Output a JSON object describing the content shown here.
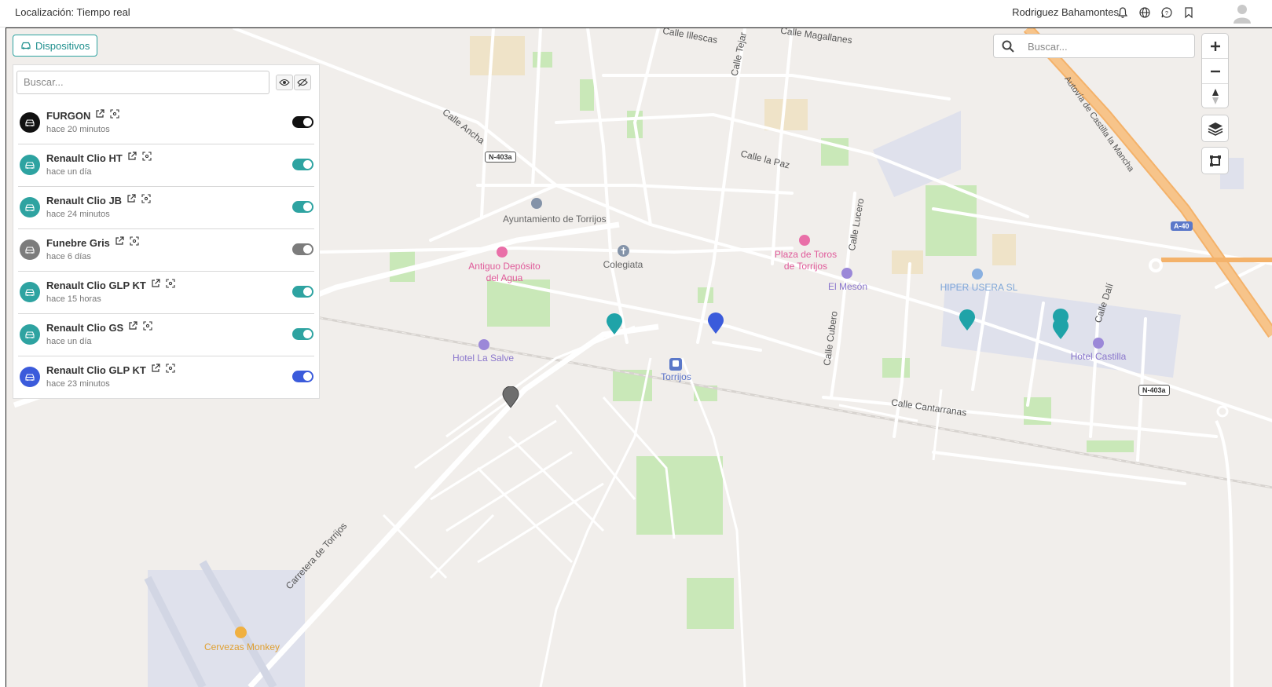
{
  "header": {
    "title": "Localización: Tiempo real",
    "user": "Rodriguez Bahamontes"
  },
  "devices_button": {
    "label": "Dispositivos"
  },
  "panel": {
    "search_placeholder": "Buscar...",
    "devices": [
      {
        "name": "FURGON",
        "last_seen": "hace 20 minutos",
        "color": "#111111",
        "enabled": true
      },
      {
        "name": "Renault Clio HT",
        "last_seen": "hace un día",
        "color": "#2ea3a1",
        "enabled": true
      },
      {
        "name": "Renault Clio JB",
        "last_seen": "hace 24 minutos",
        "color": "#2ea3a1",
        "enabled": true
      },
      {
        "name": "Funebre Gris",
        "last_seen": "hace 6 días",
        "color": "#7c7c7c",
        "enabled": true
      },
      {
        "name": "Renault Clio GLP KT",
        "last_seen": "hace 15 horas",
        "color": "#2ea3a1",
        "enabled": true
      },
      {
        "name": "Renault Clio GS",
        "last_seen": "hace un día",
        "color": "#2ea3a1",
        "enabled": true
      },
      {
        "name": "Renault Clio GLP KT",
        "last_seen": "hace 23 minutos",
        "color": "#3b5bdb",
        "enabled": true
      }
    ]
  },
  "map_search": {
    "placeholder": "Buscar..."
  },
  "map": {
    "streets": {
      "calle_illescas": "Calle Illescas",
      "calle_tejar": "Calle Tejar",
      "calle_magallanes": "Calle Magallanes",
      "calle_ancha": "Calle Ancha",
      "calle_la_paz": "Calle la Paz",
      "calle_lucero": "Calle Lucero",
      "calle_cubero": "Calle Cubero",
      "calle_dali": "Calle Dalí",
      "calle_cantarranas": "Calle Cantarranas",
      "carretera_torrijos": "Carretera de Torrijos",
      "autovia": "Autovía de Castilla la Mancha"
    },
    "road_shields": {
      "n403a_1": "N-403a",
      "n403a_2": "N-403a",
      "a40": "A-40"
    },
    "pois": {
      "ayuntamiento": "Ayuntamiento de Torrijos",
      "colegiata": "Colegiata",
      "antiguo_deposito": "Antiguo Depósito del Agua",
      "plaza_toros": "Plaza de Toros de Torrijos",
      "el_meson": "El Mesón",
      "hiper_usera": "HIPER USERA SL",
      "hotel_la_salve": "Hotel La Salve",
      "torrijos": "Torrijos",
      "hotel_castilla": "Hotel Castilla",
      "cervezas_monkey": "Cervezas Monkey"
    },
    "markers": [
      {
        "color": "#1fa3a8"
      },
      {
        "color": "#3b5bdb"
      },
      {
        "color": "#1fa3a8"
      },
      {
        "color": "#1fa3a8"
      },
      {
        "color": "#1fa3a8"
      },
      {
        "color": "#6e6e6e"
      }
    ]
  }
}
